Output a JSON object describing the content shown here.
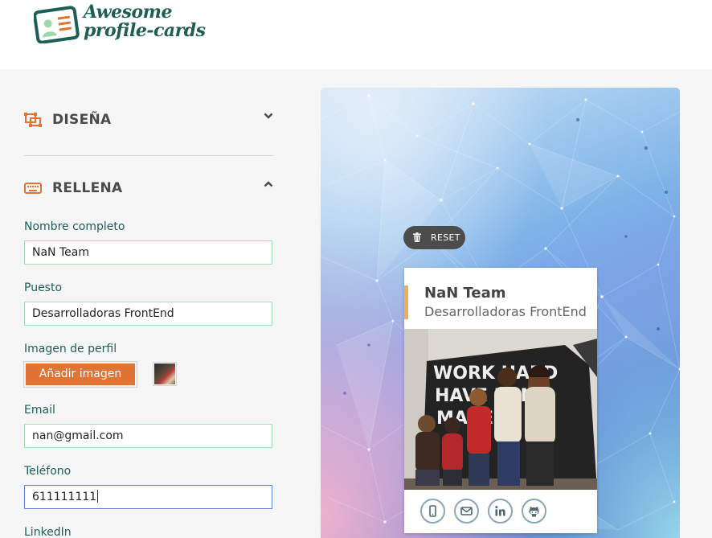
{
  "brand": {
    "logo_line1": "Awesome",
    "logo_line2": "profile-cards"
  },
  "sections": {
    "design": {
      "title": "DISEÑA",
      "expanded": false
    },
    "fill": {
      "title": "RELLENA",
      "expanded": true
    }
  },
  "form": {
    "name": {
      "label": "Nombre completo",
      "value": "NaN Team"
    },
    "job": {
      "label": "Puesto",
      "value": "Desarrolladoras FrontEnd"
    },
    "image": {
      "label": "Imagen de perfil",
      "button": "Añadir imagen"
    },
    "email": {
      "label": "Email",
      "value": "nan@gmail.com"
    },
    "phone": {
      "label": "Teléfono",
      "value": "611111111"
    },
    "linkedin": {
      "label": "LinkedIn"
    }
  },
  "preview": {
    "reset_label": "RESET",
    "card": {
      "name": "NaN Team",
      "job": "Desarrolladoras FrontEnd",
      "photo_wall_text": [
        "WORK HARD",
        "HAVE FUN",
        "MAKE"
      ]
    },
    "social_icons": [
      "phone-icon",
      "email-icon",
      "linkedin-icon",
      "github-icon"
    ]
  },
  "colors": {
    "brand_green": "#1f5e55",
    "accent_orange": "#e17334",
    "input_border": "#a2deb2",
    "card_accent": "#e8b252"
  }
}
